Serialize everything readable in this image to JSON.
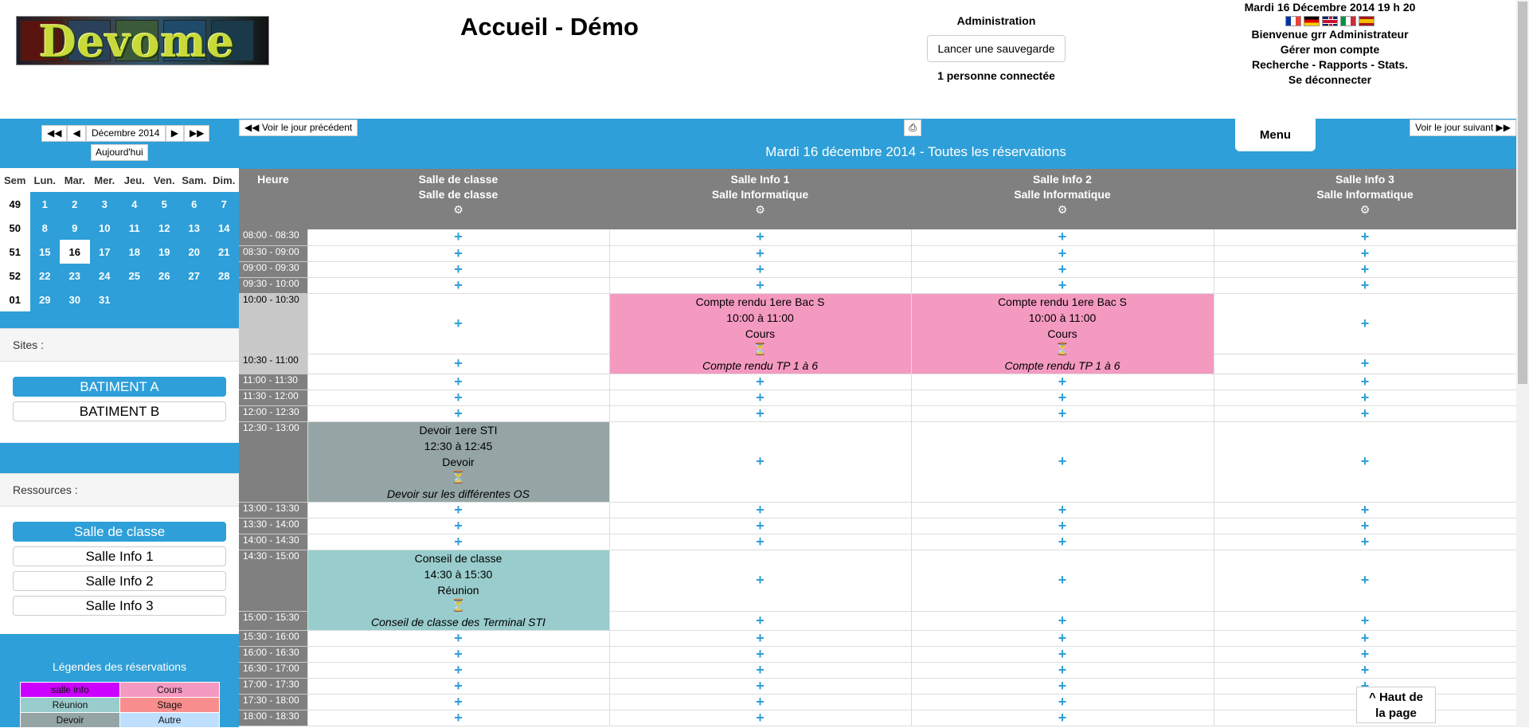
{
  "header": {
    "logo_text": "Devome",
    "page_title": "Accueil - Démo",
    "admin_label": "Administration",
    "backup_button": "Lancer une sauvegarde",
    "connected": "1 personne connectée",
    "datetime": "Mardi 16 Décembre 2014  19 h 20",
    "welcome": "Bienvenue grr Administrateur",
    "account": "Gérer mon compte",
    "links": "Recherche - Rapports - Stats.",
    "logout": "Se déconnecter"
  },
  "mini_calendar": {
    "month": "Décembre 2014",
    "today_button": "Aujourd'hui",
    "headers": [
      "Sem",
      "Lun.",
      "Mar.",
      "Mer.",
      "Jeu.",
      "Ven.",
      "Sam.",
      "Dim."
    ],
    "weeks": [
      [
        "49",
        "1",
        "2",
        "3",
        "4",
        "5",
        "6",
        "7"
      ],
      [
        "50",
        "8",
        "9",
        "10",
        "11",
        "12",
        "13",
        "14"
      ],
      [
        "51",
        "15",
        "16",
        "17",
        "18",
        "19",
        "20",
        "21"
      ],
      [
        "52",
        "22",
        "23",
        "24",
        "25",
        "26",
        "27",
        "28"
      ],
      [
        "01",
        "29",
        "30",
        "31",
        "",
        "",
        "",
        ""
      ]
    ],
    "today": "16"
  },
  "sites": {
    "title": "Sites :",
    "items": [
      "BATIMENT A",
      "BATIMENT B"
    ]
  },
  "resources": {
    "title": "Ressources :",
    "items": [
      "Salle de classe",
      "Salle Info 1",
      "Salle Info 2",
      "Salle Info 3"
    ]
  },
  "legend": {
    "title": "Légendes des réservations",
    "items": [
      {
        "label": "salle info",
        "color": "#cc00ff"
      },
      {
        "label": "Cours",
        "color": "#f49ac1"
      },
      {
        "label": "Réunion",
        "color": "#99cccc"
      },
      {
        "label": "Stage",
        "color": "#f88e8e"
      },
      {
        "label": "Devoir",
        "color": "#95a5a6"
      },
      {
        "label": "Autre",
        "color": "#bfdfff"
      }
    ]
  },
  "nav": {
    "prev_day": "Voir le jour précédent",
    "next_day": "Voir le jour suivant",
    "menu": "Menu",
    "day_title": "Mardi 16 décembre 2014 - Toutes les réservations",
    "top_button_1": "^ Haut de",
    "top_button_2": "la page"
  },
  "grid": {
    "time_header": "Heure",
    "columns": [
      {
        "name": "Salle de classe",
        "sub": "Salle de classe"
      },
      {
        "name": "Salle Info 1",
        "sub": "Salle Informatique"
      },
      {
        "name": "Salle Info 2",
        "sub": "Salle Informatique"
      },
      {
        "name": "Salle Info 3",
        "sub": "Salle Informatique"
      }
    ],
    "slots": [
      "08:00 - 08:30",
      "08:30 - 09:00",
      "09:00 - 09:30",
      "09:30 - 10:00",
      "10:00 - 10:30",
      "10:30 - 11:00",
      "11:00 - 11:30",
      "11:30 - 12:00",
      "12:00 - 12:30",
      "12:30 - 13:00",
      "13:00 - 13:30",
      "13:30 - 14:00",
      "14:00 - 14:30",
      "14:30 - 15:00",
      "15:00 - 15:30",
      "15:30 - 16:00",
      "16:00 - 16:30",
      "16:30 - 17:00",
      "17:00 - 17:30",
      "17:30 - 18:00",
      "18:00 - 18:30"
    ],
    "events": [
      {
        "title": "Compte rendu 1ere Bac S",
        "time": "10:00 à 11:00",
        "type": "Cours",
        "desc": "Compte rendu TP 1 à 6"
      },
      {
        "title": "Compte rendu 1ere Bac S",
        "time": "10:00 à 11:00",
        "type": "Cours",
        "desc": "Compte rendu TP 1 à 6"
      },
      {
        "title": "Devoir 1ere STI",
        "time": "12:30 à 12:45",
        "type": "Devoir",
        "desc": "Devoir sur les différentes OS"
      },
      {
        "title": "Conseil de classe",
        "time": "14:30 à 15:30",
        "type": "Réunion",
        "desc": "Conseil de classe des Terminal STI"
      }
    ]
  }
}
